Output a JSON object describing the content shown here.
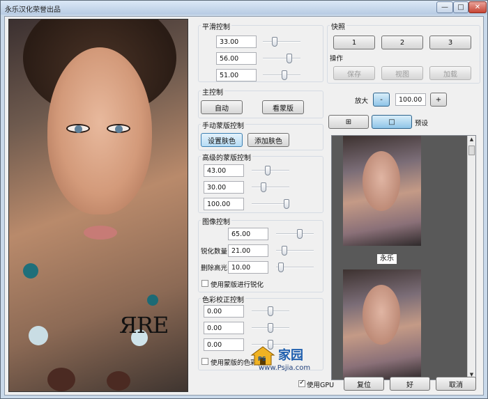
{
  "window": {
    "title": "永乐汉化荣誉出品",
    "minimize_glyph": "—",
    "maximize_glyph": "□",
    "close_glyph": "✕"
  },
  "photo": {
    "watermark": "ЯRE"
  },
  "smooth": {
    "title": "平滑控制",
    "values": [
      "33.00",
      "56.00",
      "51.00"
    ],
    "slider_levels": [
      0.25,
      0.62,
      0.52
    ]
  },
  "master": {
    "title": "主控制",
    "auto_label": "自动",
    "view_mask_label": "看蒙版"
  },
  "manual_mask": {
    "title": "手动蒙版控制",
    "set_skin_label": "设置肤色",
    "add_skin_label": "添加肤色"
  },
  "advanced_mask": {
    "title": "高级的蒙版控制",
    "values": [
      "43.00",
      "30.00",
      "100.00"
    ],
    "slider_levels": [
      0.43,
      0.3,
      1.0
    ]
  },
  "image": {
    "title": "图像控制",
    "value1": "65.00",
    "sharpen_label": "锐化数量",
    "sharpen_value": "21.00",
    "highlight_label": "删除高光",
    "highlight_value": "10.00",
    "slider_levels": [
      0.65,
      0.21,
      0.1
    ],
    "use_mask_sharpen_label": "使用蒙版进行锐化"
  },
  "color": {
    "title": "色彩校正控制",
    "values": [
      "0.00",
      "0.00",
      "0.00"
    ],
    "slider_levels": [
      0.5,
      0.5,
      0.5
    ],
    "use_mask_color_label": "使用蒙版的色彩校"
  },
  "snapshot": {
    "title": "快照",
    "buttons": [
      "1",
      "2",
      "3"
    ],
    "ops_title": "操作",
    "save_label": "保存",
    "view_label": "视图",
    "load_label": "加载"
  },
  "zoom": {
    "label": "放大",
    "minus_label": "-",
    "value": "100.00",
    "plus_label": "+"
  },
  "view_mode": {
    "grid_glyph": "⊞",
    "single_glyph": "□",
    "preset_label": "预设"
  },
  "presets": {
    "caption": "永乐",
    "scroll_up": "▲",
    "scroll_down": "▼"
  },
  "footer": {
    "use_gpu_label": "使用GPU",
    "reset_label": "复位",
    "ok_label": "好",
    "cancel_label": "取消"
  },
  "site_logo": {
    "ps": "PS",
    "brand": "家园",
    "url": "www.Psjia.com"
  }
}
